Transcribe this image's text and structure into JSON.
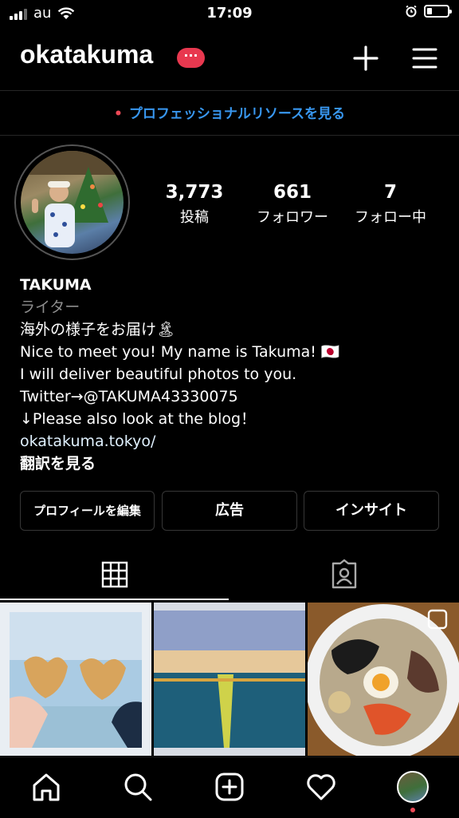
{
  "status_bar": {
    "carrier": "au",
    "time": "17:09"
  },
  "header": {
    "username": "okatakuma",
    "badge": "···"
  },
  "banner": {
    "text": "プロフェッショナルリソースを見る"
  },
  "stats": [
    {
      "num": "3,773",
      "label": "投稿"
    },
    {
      "num": "661",
      "label": "フォロワー"
    },
    {
      "num": "7",
      "label": "フォロー中"
    }
  ],
  "bio": {
    "name": "TAKUMA",
    "category": "ライター",
    "line1": "海外の様子をお届け🏝",
    "line2": "Nice to meet you! My name is Takuma! 🇯🇵",
    "line3": "I will deliver beautiful photos to you.",
    "line4": "Twitter→@TAKUMA43330075",
    "line5": "↓Please also look at the blog！",
    "link": "okatakuma.tokyo/",
    "translate": "翻訳を見る"
  },
  "buttons": {
    "edit": "プロフィールを編集",
    "ads": "広告",
    "insights": "インサイト"
  },
  "icons": {
    "add": "plus-icon",
    "menu": "hamburger-icon",
    "grid": "grid-icon",
    "tagged": "tagged-icon",
    "home": "home-icon",
    "search": "search-icon",
    "new_post": "new-post-icon",
    "activity": "heart-icon"
  }
}
